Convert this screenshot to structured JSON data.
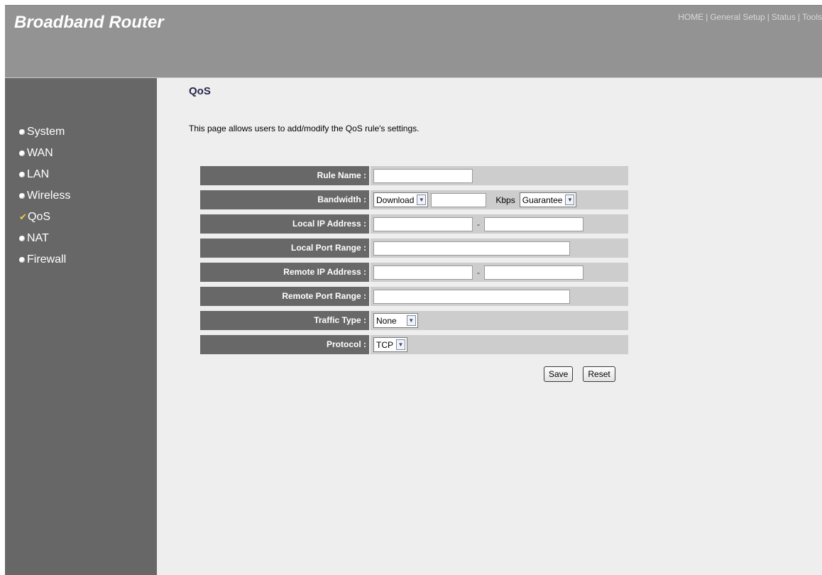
{
  "header": {
    "brand": "Broadband Router",
    "nav": [
      "HOME",
      "General Setup",
      "Status",
      "Tools"
    ]
  },
  "sidebar": {
    "items": [
      {
        "label": "System",
        "icon": "bullet-icon"
      },
      {
        "label": "WAN",
        "icon": "bullet-icon"
      },
      {
        "label": "LAN",
        "icon": "bullet-icon"
      },
      {
        "label": "Wireless",
        "icon": "bullet-icon"
      },
      {
        "label": "QoS",
        "icon": "check-icon",
        "active": true
      },
      {
        "label": "NAT",
        "icon": "bullet-icon"
      },
      {
        "label": "Firewall",
        "icon": "bullet-icon"
      }
    ]
  },
  "main": {
    "title": "QoS",
    "description": "This page allows users to add/modify the QoS rule's settings."
  },
  "form": {
    "rule_name": {
      "label": "Rule Name :",
      "value": ""
    },
    "bandwidth": {
      "label": "Bandwidth :",
      "direction": "Download",
      "value": "",
      "unit": "Kbps",
      "mode": "Guarantee"
    },
    "local_ip": {
      "label": "Local IP Address :",
      "start": "",
      "separator": "-",
      "end": ""
    },
    "local_port": {
      "label": "Local Port Range :",
      "value": ""
    },
    "remote_ip": {
      "label": "Remote IP Address :",
      "start": "",
      "separator": "-",
      "end": ""
    },
    "remote_port": {
      "label": "Remote Port Range :",
      "value": ""
    },
    "traffic_type": {
      "label": "Traffic Type :",
      "value": "None"
    },
    "protocol": {
      "label": "Protocol :",
      "value": "TCP"
    }
  },
  "buttons": {
    "save": "Save",
    "reset": "Reset"
  },
  "colors": {
    "header": "#939393",
    "sidebar": "#676767",
    "content": "#eeeeee",
    "label_cell": "#686868",
    "value_cell": "#cdcdcd",
    "title": "#24284a"
  }
}
